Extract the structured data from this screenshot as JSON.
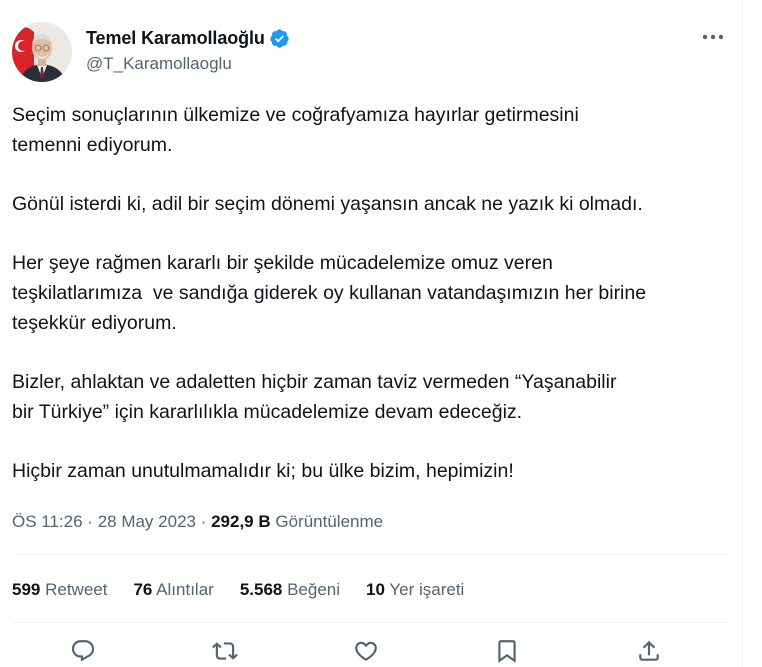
{
  "author": {
    "display_name": "Temel Karamollaoğlu",
    "handle": "@T_Karamollaoglu",
    "verified": true
  },
  "tweet": {
    "paragraphs": [
      [
        "Seçim sonuçlarının ülkemize ve coğrafyamıza hayırlar getirmesini",
        "temenni ediyorum."
      ],
      [
        "Gönül isterdi ki, adil bir seçim dönemi yaşansın ancak ne yazık ki olmadı."
      ],
      [
        "Her şeye rağmen kararlı bir şekilde mücadelemize omuz veren",
        "teşkilatlarımıza  ve sandığa giderek oy kullanan vatandaşımızın her birine",
        "teşekkür ediyorum."
      ],
      [
        "Bizler, ahlaktan ve adaletten hiçbir zaman taviz vermeden “Yaşanabilir",
        "bir Türkiye” için kararlılıkla mücadelemize devam edeceğiz."
      ],
      [
        "Hiçbir zaman unutulmamalıdır ki; bu ülke bizim, hepimizin!"
      ]
    ]
  },
  "meta": {
    "time": "ÖS 11:26",
    "separator": " · ",
    "date": "28 May 2023",
    "views_count": "292,9 B",
    "views_label": " Görüntülenme"
  },
  "stats": {
    "retweets": {
      "count": "599",
      "label": " Retweet"
    },
    "quotes": {
      "count": "76",
      "label": " Alıntılar"
    },
    "likes": {
      "count": "5.568",
      "label": " Beğeni"
    },
    "bookmarks": {
      "count": "10",
      "label": " Yer işareti"
    }
  },
  "actions": [
    "reply-icon",
    "retweet-icon",
    "like-icon",
    "bookmark-icon",
    "share-icon"
  ],
  "colors": {
    "text": "#0f1419",
    "secondary": "#536471",
    "verified": "#1d9bf0",
    "divider": "#eff3f4"
  }
}
